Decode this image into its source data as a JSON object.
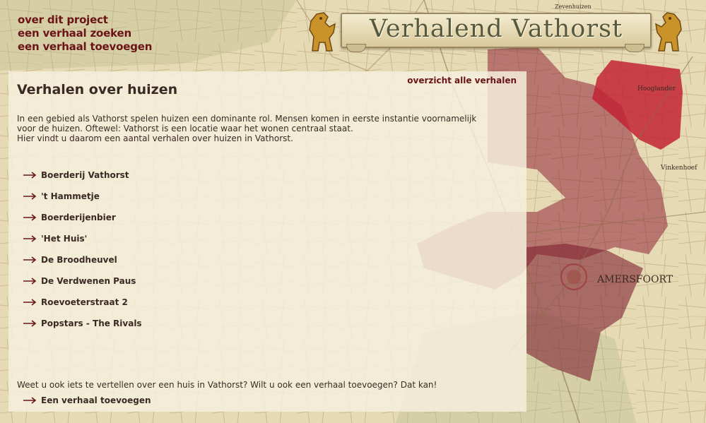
{
  "nav": {
    "items": [
      "over dit project",
      "een verhaal zoeken",
      "een verhaal toevoegen"
    ]
  },
  "banner": {
    "title": "Verhalend Vathorst"
  },
  "map_labels": {
    "town": "AMERSFOORT",
    "vinkenhoef": "Vinkenhoef",
    "hooglanderveen": "Hooglander",
    "zevenhuizen": "Zevenhuizen"
  },
  "panel": {
    "overview_link": "overzicht alle verhalen",
    "title": "Verhalen over huizen",
    "intro": [
      "In een gebied als Vathorst spelen huizen een dominante rol. Mensen komen in eerste instantie voornamelijk",
      "voor de huizen. Oftewel: Vathorst is een locatie waar het wonen centraal staat.",
      "Hier vindt u daarom een aantal verhalen over huizen in Vathorst."
    ],
    "stories": [
      "Boerderij Vathorst",
      "'t Hammetje",
      "Boerderijenbier",
      "'Het Huis'",
      "De Broodheuvel",
      "De Verdwenen Paus",
      "Roevoeterstraat 2",
      "Popstars - The Rivals"
    ],
    "footer_text": "Weet u ook iets te vertellen over een huis in Vathorst? Wilt u ook een verhaal toevoegen? Dat kan!",
    "footer_link": "Een verhaal toevoegen"
  },
  "colors": {
    "link": "#6b1418",
    "text": "#3b2a24",
    "map_paper": "#e4d8b2",
    "region_fill": "#8f2435",
    "region_highlight": "#c22335"
  }
}
